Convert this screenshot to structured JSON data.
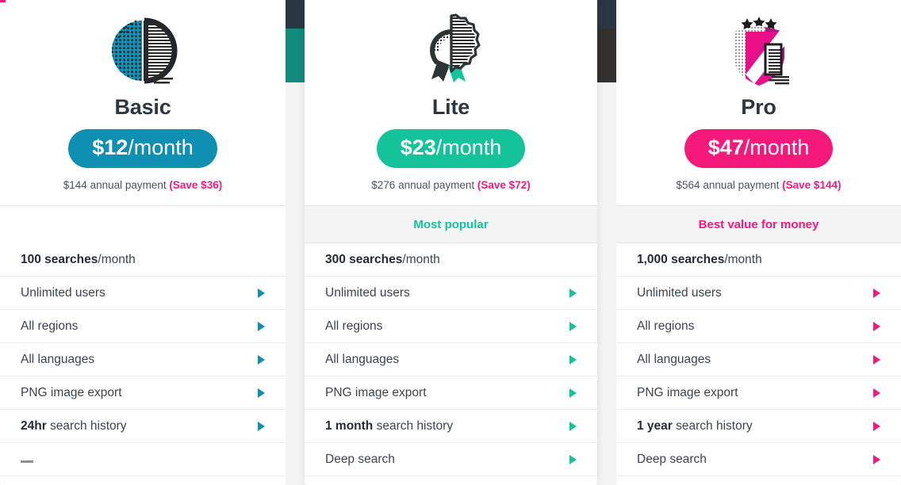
{
  "colors": {
    "basic_accent": "#0f90b2",
    "lite_accent": "#14c39a",
    "pro_accent": "#f5197c",
    "dark_strip": "#2b3744",
    "teal_strip": "#128a7d",
    "black_strip": "#32312f",
    "badge_bg": "#f4f4f4",
    "text": "#3c434f"
  },
  "plans": [
    {
      "id": "basic",
      "icon": "half-circle-dotted-icon",
      "name": "Basic",
      "price_amount": "$12",
      "price_period": "/month",
      "annual_text": "$144 annual payment",
      "annual_save": "(Save $36)",
      "badge": "",
      "has_badge": false,
      "features": [
        {
          "bold": "100 searches",
          "rest": "/month",
          "arrow": false,
          "dash": false
        },
        {
          "bold": "",
          "rest": "Unlimited users",
          "arrow": true,
          "dash": false
        },
        {
          "bold": "",
          "rest": "All regions",
          "arrow": true,
          "dash": false
        },
        {
          "bold": "",
          "rest": "All languages",
          "arrow": true,
          "dash": false
        },
        {
          "bold": "",
          "rest": "PNG image export",
          "arrow": true,
          "dash": false
        },
        {
          "bold": "24hr",
          "rest": " search history",
          "arrow": true,
          "dash": false
        },
        {
          "bold": "",
          "rest": "",
          "arrow": false,
          "dash": true
        }
      ]
    },
    {
      "id": "lite",
      "icon": "award-rosette-icon",
      "name": "Lite",
      "price_amount": "$23",
      "price_period": "/month",
      "annual_text": "$276 annual payment",
      "annual_save": "(Save $72)",
      "badge": "Most popular",
      "has_badge": true,
      "features": [
        {
          "bold": "300 searches",
          "rest": "/month",
          "arrow": false,
          "dash": false
        },
        {
          "bold": "",
          "rest": "Unlimited users",
          "arrow": true,
          "dash": false
        },
        {
          "bold": "",
          "rest": "All regions",
          "arrow": true,
          "dash": false
        },
        {
          "bold": "",
          "rest": "All languages",
          "arrow": true,
          "dash": false
        },
        {
          "bold": "",
          "rest": "PNG image export",
          "arrow": true,
          "dash": false
        },
        {
          "bold": "1 month",
          "rest": " search history",
          "arrow": true,
          "dash": false
        },
        {
          "bold": "",
          "rest": "Deep search",
          "arrow": true,
          "dash": false
        }
      ]
    },
    {
      "id": "pro",
      "icon": "shield-three-stars-icon",
      "name": "Pro",
      "price_amount": "$47",
      "price_period": "/month",
      "annual_text": "$564 annual payment",
      "annual_save": "(Save $144)",
      "badge": "Best value for money",
      "has_badge": true,
      "features": [
        {
          "bold": "1,000 searches",
          "rest": "/month",
          "arrow": false,
          "dash": false
        },
        {
          "bold": "",
          "rest": "Unlimited users",
          "arrow": true,
          "dash": false
        },
        {
          "bold": "",
          "rest": "All regions",
          "arrow": true,
          "dash": false
        },
        {
          "bold": "",
          "rest": "All languages",
          "arrow": true,
          "dash": false
        },
        {
          "bold": "",
          "rest": "PNG image export",
          "arrow": true,
          "dash": false
        },
        {
          "bold": "1 year",
          "rest": " search history",
          "arrow": true,
          "dash": false
        },
        {
          "bold": "",
          "rest": "Deep search",
          "arrow": true,
          "dash": false
        }
      ]
    }
  ]
}
